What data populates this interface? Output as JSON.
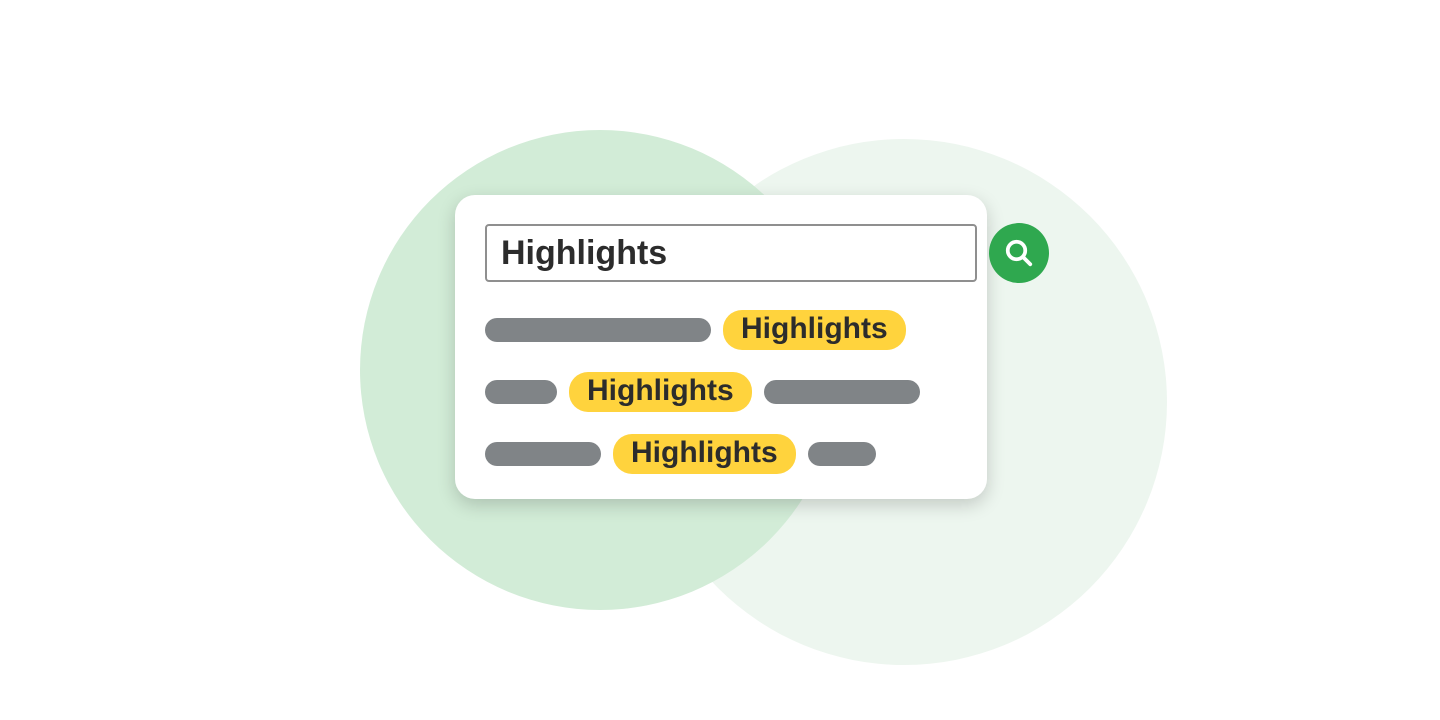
{
  "search": {
    "value": "Highlights"
  },
  "results": {
    "row1": {
      "highlight": "Highlights"
    },
    "row2": {
      "highlight": "Highlights"
    },
    "row3": {
      "highlight": "Highlights"
    }
  },
  "colors": {
    "accent_green": "#2fa84f",
    "highlight_yellow": "#ffd33d",
    "circle_dark": "#d2ecd7",
    "circle_light": "#edf6ef",
    "placeholder_gray": "#808487"
  }
}
